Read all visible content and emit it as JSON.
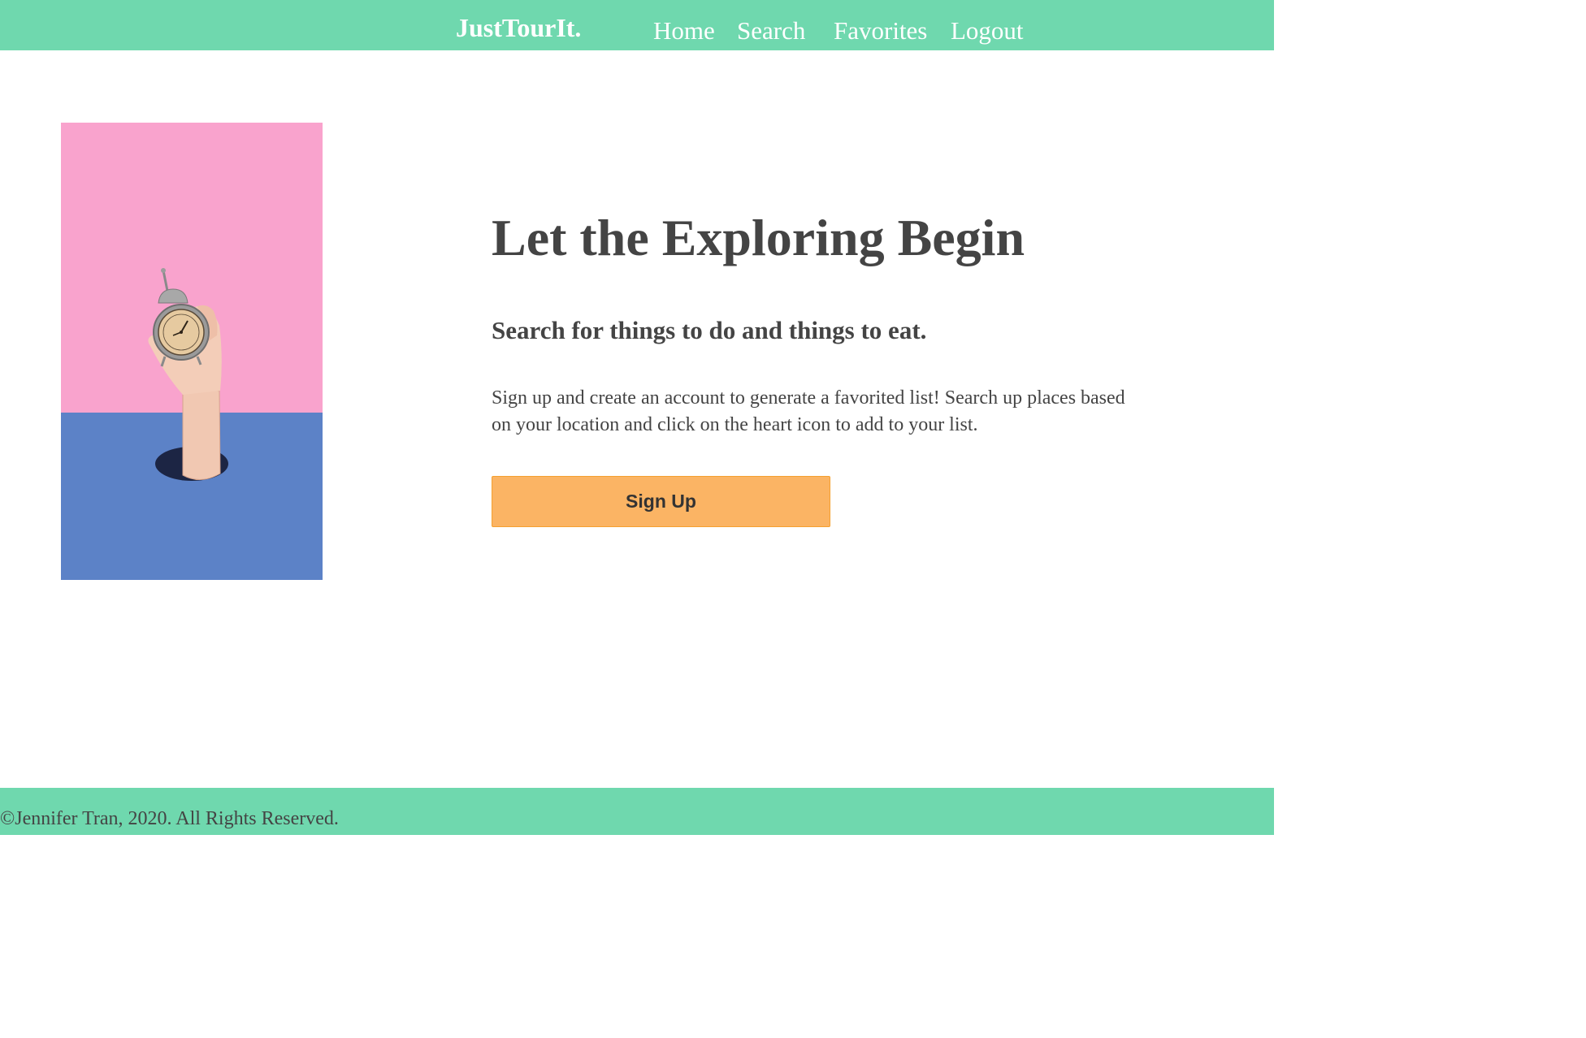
{
  "nav": {
    "brand": "JustTourIt.",
    "links": [
      "Home",
      "Search",
      "Favorites",
      "Logout"
    ]
  },
  "hero": {
    "headline": "Let the Exploring Begin",
    "subheadline": "Search for things to do and things to eat.",
    "description": "Sign up and create an account to generate a favorited list! Search up places based on your location and click on the heart icon to add to your list.",
    "cta_label": "Sign Up"
  },
  "footer": {
    "copyright": "©Jennifer Tran, 2020. All Rights Reserved."
  },
  "colors": {
    "header_bg": "#6fd8ae",
    "footer_bg": "#6fd8ae",
    "button_bg": "#fbb464",
    "text": "#444444",
    "image_top": "#f9a3cd",
    "image_bottom": "#5c82c7"
  }
}
